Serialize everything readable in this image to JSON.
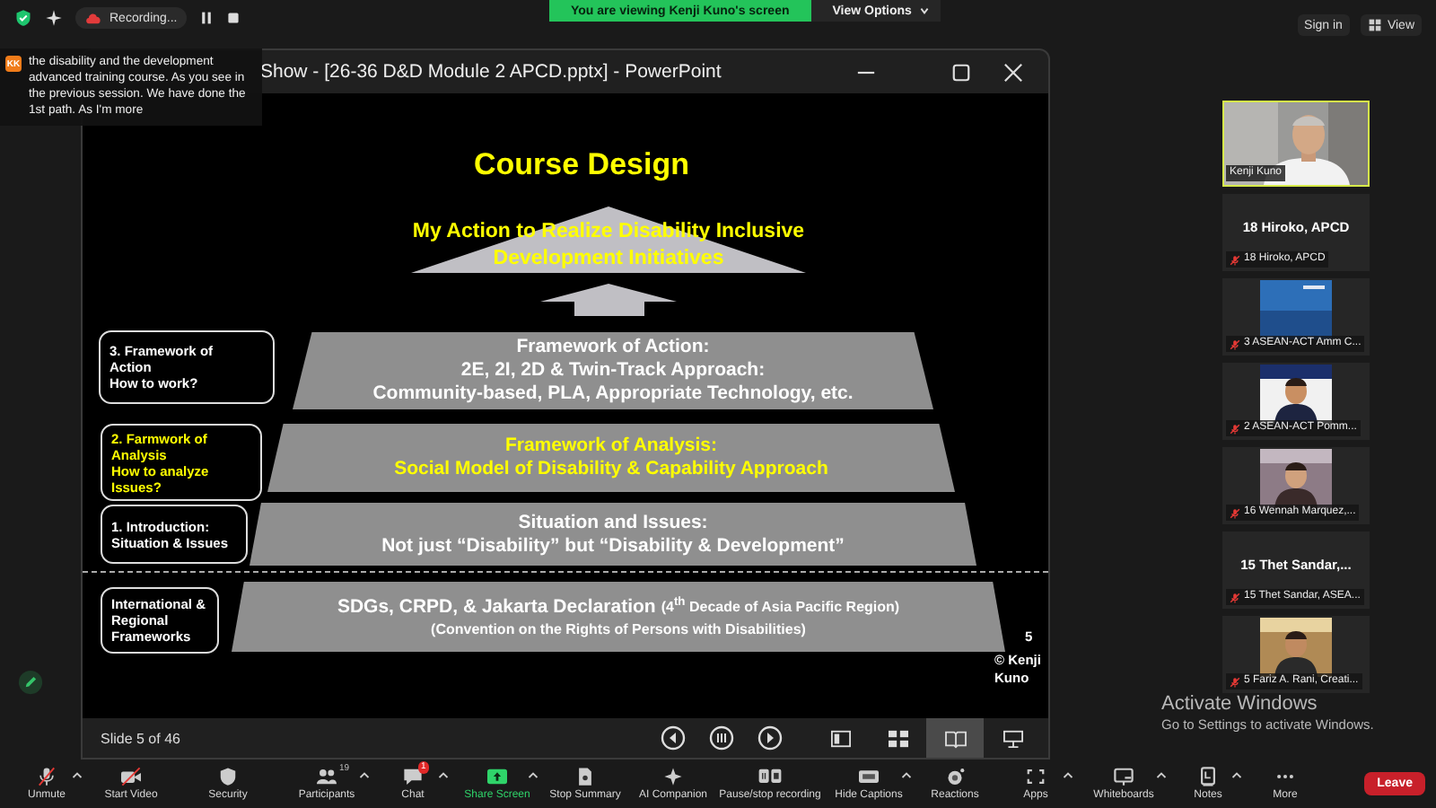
{
  "top_bar": {
    "recording": "Recording...",
    "banner": "You are viewing Kenji Kuno's screen",
    "view_options": "View Options",
    "sign_in": "Sign in",
    "view": "View"
  },
  "caption": {
    "avatar": "KK",
    "text": "the disability and the development advanced training course. As you see in the previous session. We have done the 1st path. As I'm more"
  },
  "shared_window": {
    "title": "Show - [26-36 D&D Module 2 APCD.pptx] - PowerPoint",
    "slide": {
      "title": "Course Design",
      "goal": [
        "My Action to Realize Disability Inclusive",
        "Development Initiatives"
      ],
      "layers": [
        {
          "highlighted": false,
          "lines": [
            {
              "text": "Framework of Action:",
              "small": false
            },
            {
              "text": "2E, 2I, 2D  &  Twin-Track Approach:",
              "small": false
            },
            {
              "text": "Community-based, PLA, Appropriate Technology, etc.",
              "small": false
            }
          ]
        },
        {
          "highlighted": true,
          "lines": [
            {
              "text": "Framework of Analysis:",
              "small": false
            },
            {
              "text": "Social Model of Disability & Capability Approach",
              "small": false
            }
          ]
        },
        {
          "highlighted": false,
          "lines": [
            {
              "text": "Situation and Issues:",
              "small": false
            },
            {
              "text": "Not just “Disability” but “Disability & Development”",
              "small": false
            }
          ]
        },
        {
          "highlighted": false,
          "lines": [
            {
              "text": "SDGs, CRPD, & Jakarta Declaration",
              "note": "(4$^{th}$ Decade of Asia Pacific Region)",
              "small": false
            },
            {
              "text": "(Convention on the Rights of Persons with Disabilities)",
              "small": true
            }
          ]
        }
      ],
      "labels": [
        {
          "highlighted": false,
          "lines": [
            "3. Framework of",
            "Action",
            "How to work?"
          ]
        },
        {
          "highlighted": true,
          "lines": [
            "2. Farmwork of",
            "Analysis",
            "How to analyze",
            "Issues?"
          ]
        },
        {
          "highlighted": false,
          "lines": [
            "1. Introduction:",
            "Situation & Issues"
          ]
        },
        {
          "highlighted": false,
          "lines": [
            "International &",
            "Regional",
            "Frameworks"
          ]
        }
      ],
      "page_number": "5",
      "credit": "© Kenji Kuno"
    },
    "status": "Slide 5 of 46",
    "views": [
      {
        "selected": false
      },
      {
        "selected": false
      },
      {
        "selected": true
      },
      {
        "selected": false
      }
    ]
  },
  "participants": [
    {
      "kind": "video",
      "name": "Kenji Kuno",
      "muted": false,
      "speaking": true
    },
    {
      "kind": "avatar",
      "display_name": "18 Hiroko, APCD",
      "name": "18 Hiroko, APCD",
      "muted": true,
      "speaking": false
    },
    {
      "kind": "video",
      "name": "3 ASEAN-ACT Amm C...",
      "muted": true,
      "speaking": false
    },
    {
      "kind": "video",
      "name": "2 ASEAN-ACT Pomm...",
      "muted": true,
      "speaking": false
    },
    {
      "kind": "video",
      "name": "16 Wennah Marquez,...",
      "muted": true,
      "speaking": false
    },
    {
      "kind": "avatar",
      "display_name": "15 Thet Sandar,...",
      "name": "15 Thet Sandar, ASEA...",
      "muted": true,
      "speaking": false
    },
    {
      "kind": "video",
      "name": "5 Fariz A. Rani, Creati...",
      "muted": true,
      "speaking": false
    }
  ],
  "activation": {
    "title": "Activate Windows",
    "hint": "Go to Settings to activate Windows."
  },
  "toolbar": {
    "items": [
      {
        "label": "Unmute",
        "caret": true,
        "highlighted": false
      },
      {
        "label": "Start Video",
        "caret": false,
        "highlighted": false
      },
      {
        "label": "Security",
        "caret": false,
        "highlighted": false
      },
      {
        "label": "Participants",
        "count": "19",
        "caret": true,
        "highlighted": false
      },
      {
        "label": "Chat",
        "badge": "1",
        "caret": true,
        "highlighted": false
      },
      {
        "label": "Share Screen",
        "caret": true,
        "highlighted": true
      },
      {
        "label": "Stop Summary",
        "caret": false,
        "highlighted": false
      },
      {
        "label": "AI Companion",
        "caret": false,
        "highlighted": false
      },
      {
        "label": "Pause/stop recording",
        "caret": false,
        "highlighted": false
      },
      {
        "label": "Hide Captions",
        "caret": true,
        "highlighted": false
      },
      {
        "label": "Reactions",
        "caret": false,
        "highlighted": false
      },
      {
        "label": "Apps",
        "caret": true,
        "highlighted": false
      },
      {
        "label": "Whiteboards",
        "caret": true,
        "highlighted": false
      },
      {
        "label": "Notes",
        "caret": true,
        "highlighted": false
      },
      {
        "label": "More",
        "caret": false,
        "highlighted": false
      }
    ],
    "leave": "Leave"
  }
}
